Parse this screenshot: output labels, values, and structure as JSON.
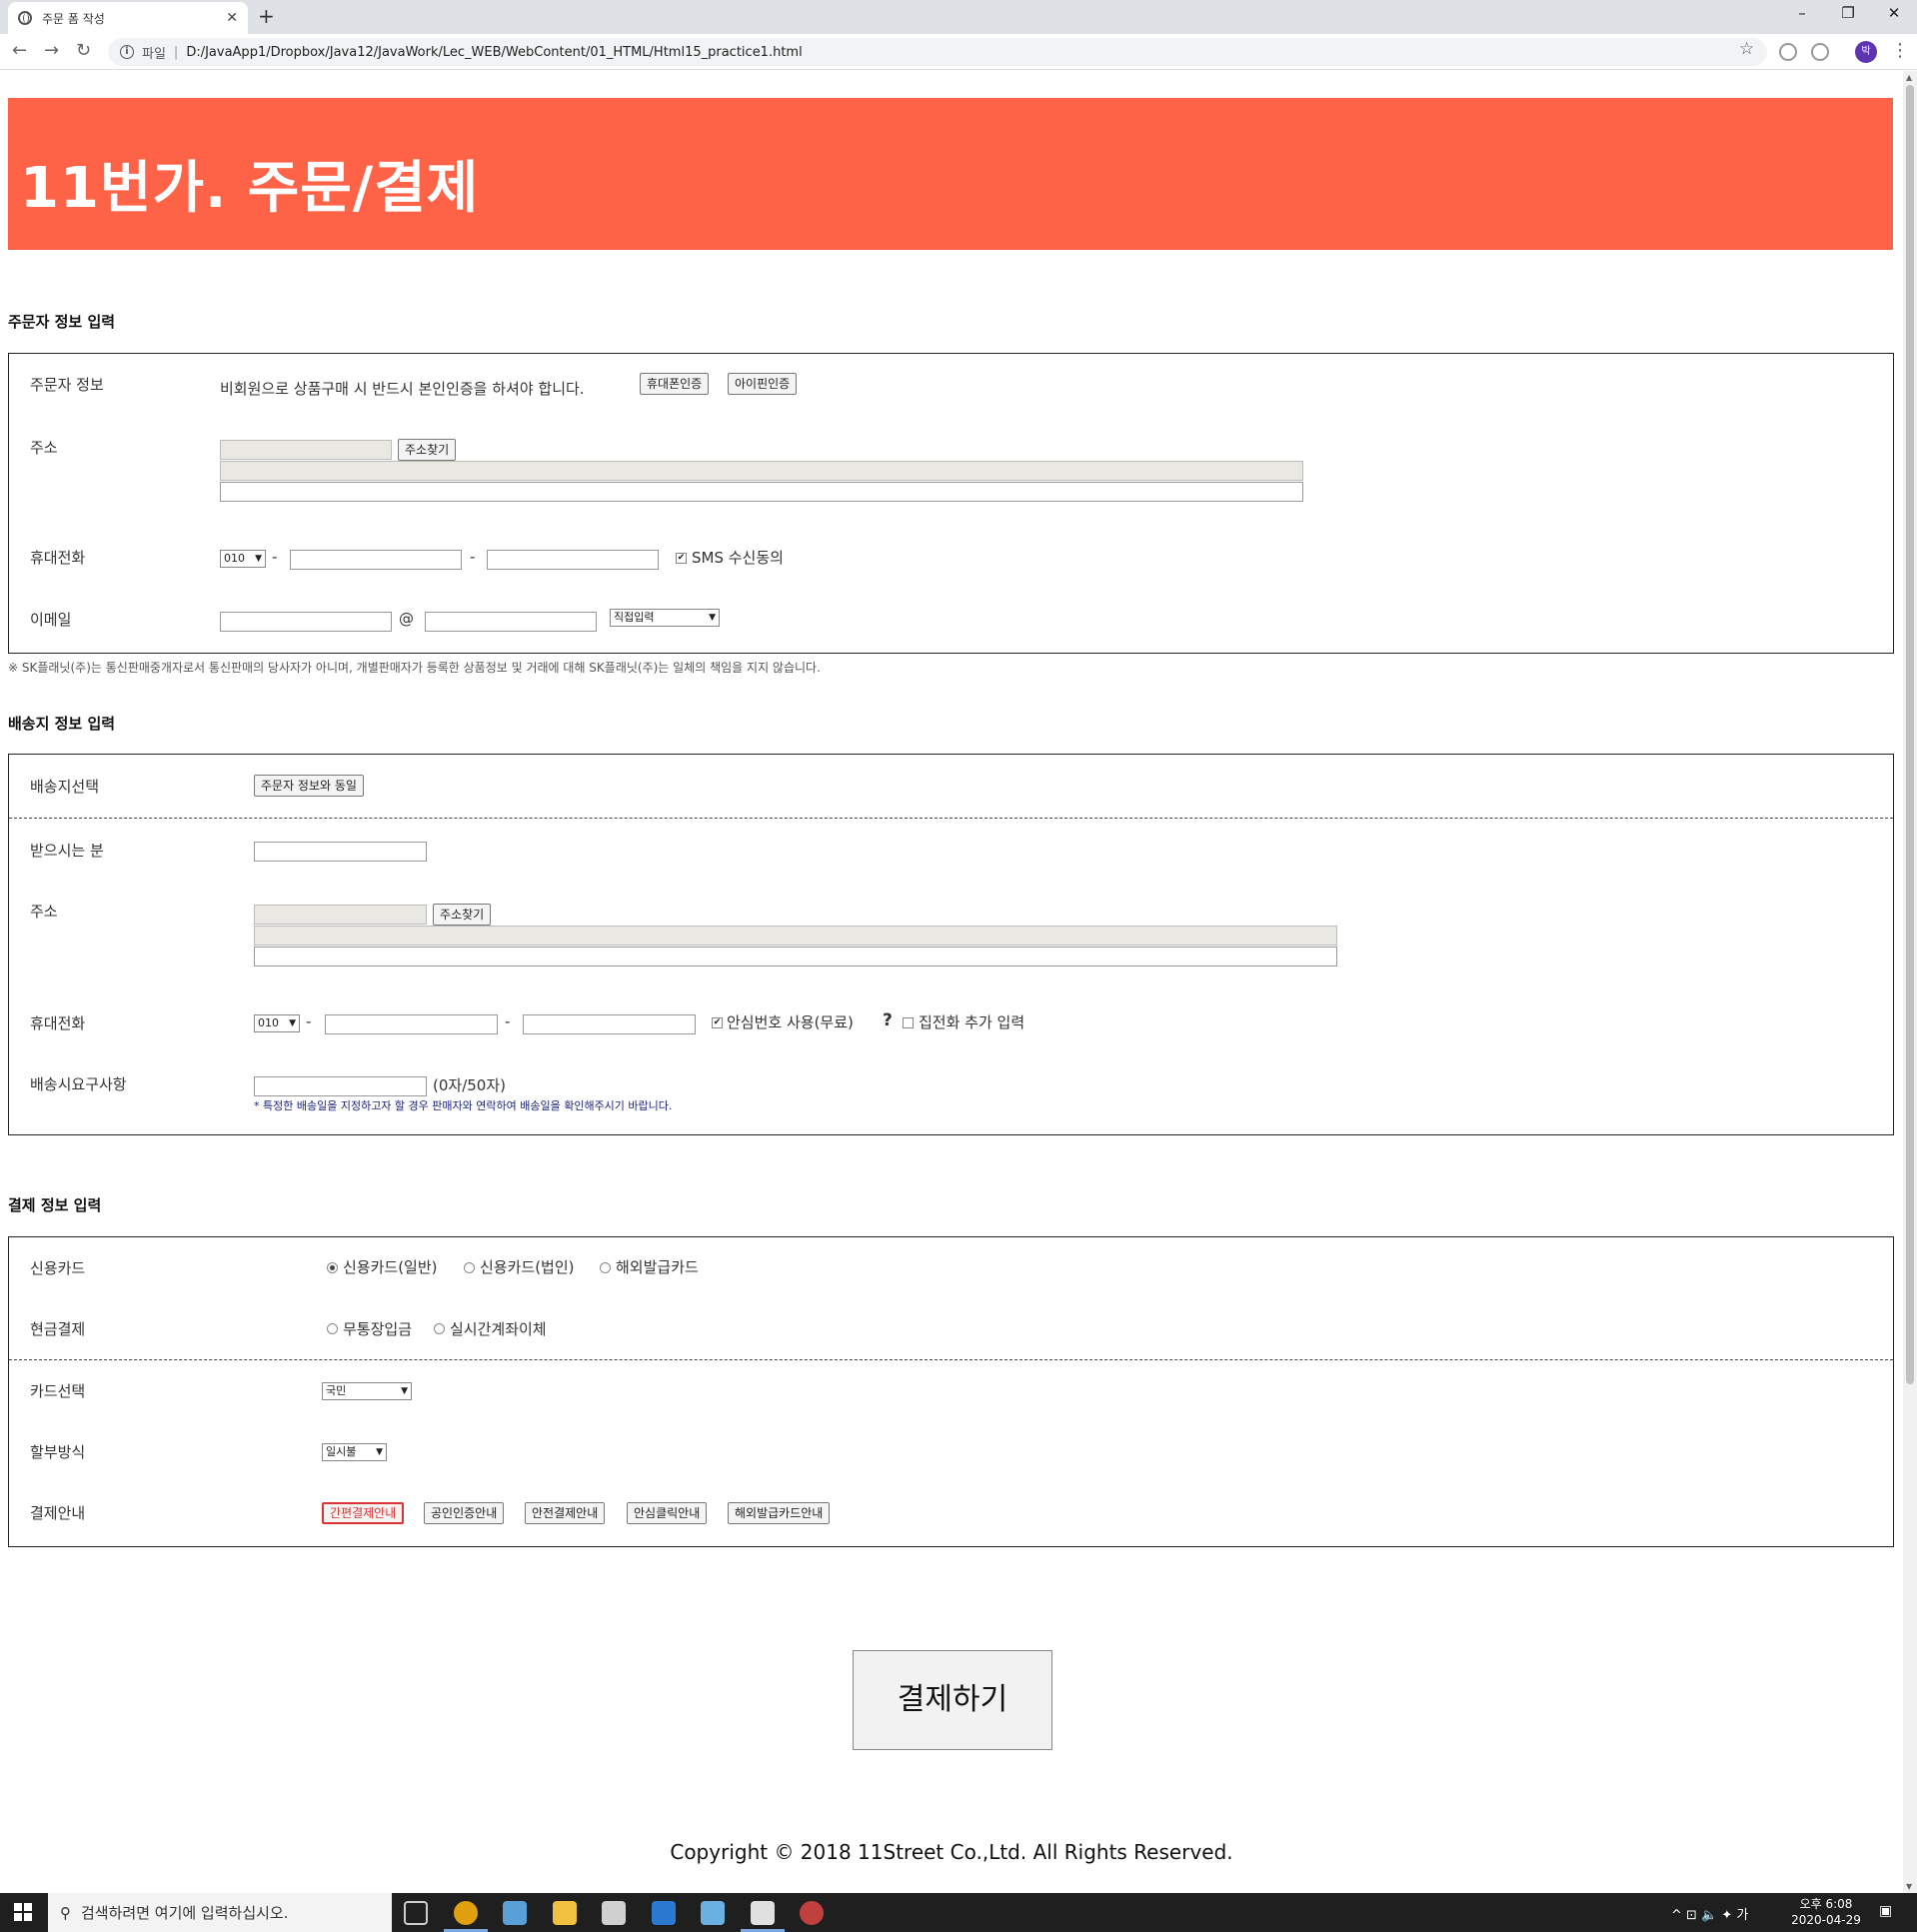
{
  "browser": {
    "tab_title": "주문 폼 작성",
    "tab_close": "✕",
    "new_tab": "+",
    "window_min": "–",
    "window_restore": "❐",
    "window_close": "✕",
    "back": "←",
    "forward": "→",
    "reload": "↻",
    "info": "i",
    "scheme": "파일",
    "separator": "|",
    "url": "D:/JavaApp1/Dropbox/Java12/JavaWork/Lec_WEB/WebContent/01_HTML/Html15_practice1.html",
    "star": "☆",
    "avatar": "박",
    "menu": "⋮"
  },
  "banner": {
    "title": "11번가. 주문/결제"
  },
  "orderer": {
    "section_title": "주문자 정보 입력",
    "info_label": "주문자 정보",
    "info_text": "비회원으로 상품구매 시 반드시 본인인증을 하셔야 합니다.",
    "phone_auth": "휴대폰인증",
    "ipin_auth": "아이핀인증",
    "address_label": "주소",
    "find_address": "주소찾기",
    "mobile_label": "휴대전화",
    "mobile_prefix": "010",
    "dash": "-",
    "sms_check": "✔",
    "sms_label": "SMS 수신동의",
    "email_label": "이메일",
    "at": "@",
    "email_domain": "직접입력",
    "notice": "※ SK플래닛(주)는 통신판매중개자로서 통신판매의 당사자가 아니며, 개별판매자가 등록한 상품정보 및 거래에 대해 SK플래닛(주)는 일체의 책임을 지지 않습니다."
  },
  "shipping": {
    "section_title": "배송지 정보 입력",
    "select_label": "배송지선택",
    "same_button": "주문자 정보와 동일",
    "recipient_label": "받으시는 분",
    "address_label": "주소",
    "find_address": "주소찾기",
    "mobile_label": "휴대전화",
    "mobile_prefix": "010",
    "dash": "-",
    "safe_check": "✔",
    "safe_label": "안심번호 사용(무료)",
    "help": "?",
    "home_label": "집전화 추가 입력",
    "request_label": "배송시요구사항",
    "counter": "(0자/50자)",
    "request_note": "* 특정한 배송일을 지정하고자 할 경우 판매자와 연락하여 배송일을 확인해주시기 바랍니다."
  },
  "payment": {
    "section_title": "결제 정보 입력",
    "card_label": "신용카드",
    "card_options": [
      "신용카드(일반)",
      "신용카드(법인)",
      "해외발급카드"
    ],
    "cash_label": "현금결제",
    "cash_options": [
      "무통장입금",
      "실시간계좌이체"
    ],
    "card_select_label": "카드선택",
    "card_selected": "국민",
    "installment_label": "할부방식",
    "installment_selected": "일시불",
    "guide_label": "결제안내",
    "guide_buttons": [
      "간편결제안내",
      "공인인증안내",
      "안전결제안내",
      "안심클릭안내",
      "해외발급카드안내"
    ],
    "submit": "결제하기"
  },
  "footer": {
    "copyright": "Copyright © 2018 11Street Co.,Ltd. All Rights Reserved."
  },
  "taskbar": {
    "search_placeholder": "검색하려면 여기에 입력하십시오.",
    "search_icon": "⚲",
    "tray": "^ ⊡ 🔈 ✦ 가",
    "time": "오후 6:08",
    "date": "2020-04-29",
    "notifications": "▣"
  },
  "colors": {
    "banner": "#ff6347",
    "accent_red": "#dd3333",
    "note_blue": "#1a237e"
  }
}
